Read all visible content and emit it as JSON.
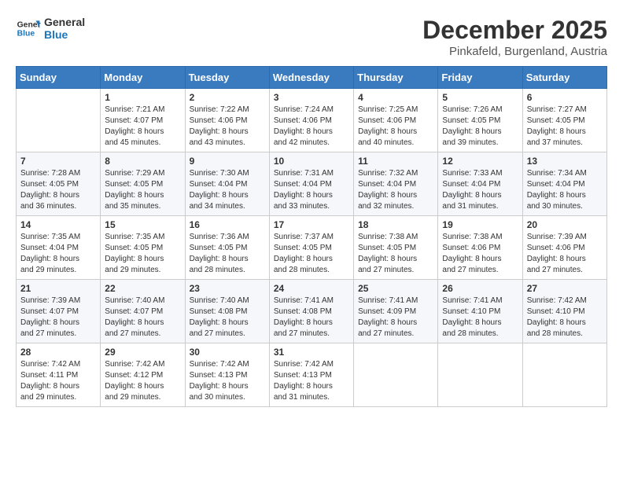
{
  "logo": {
    "line1": "General",
    "line2": "Blue"
  },
  "title": "December 2025",
  "subtitle": "Pinkafeld, Burgenland, Austria",
  "weekdays": [
    "Sunday",
    "Monday",
    "Tuesday",
    "Wednesday",
    "Thursday",
    "Friday",
    "Saturday"
  ],
  "weeks": [
    [
      {
        "day": "",
        "info": ""
      },
      {
        "day": "1",
        "info": "Sunrise: 7:21 AM\nSunset: 4:07 PM\nDaylight: 8 hours\nand 45 minutes."
      },
      {
        "day": "2",
        "info": "Sunrise: 7:22 AM\nSunset: 4:06 PM\nDaylight: 8 hours\nand 43 minutes."
      },
      {
        "day": "3",
        "info": "Sunrise: 7:24 AM\nSunset: 4:06 PM\nDaylight: 8 hours\nand 42 minutes."
      },
      {
        "day": "4",
        "info": "Sunrise: 7:25 AM\nSunset: 4:06 PM\nDaylight: 8 hours\nand 40 minutes."
      },
      {
        "day": "5",
        "info": "Sunrise: 7:26 AM\nSunset: 4:05 PM\nDaylight: 8 hours\nand 39 minutes."
      },
      {
        "day": "6",
        "info": "Sunrise: 7:27 AM\nSunset: 4:05 PM\nDaylight: 8 hours\nand 37 minutes."
      }
    ],
    [
      {
        "day": "7",
        "info": "Sunrise: 7:28 AM\nSunset: 4:05 PM\nDaylight: 8 hours\nand 36 minutes."
      },
      {
        "day": "8",
        "info": "Sunrise: 7:29 AM\nSunset: 4:05 PM\nDaylight: 8 hours\nand 35 minutes."
      },
      {
        "day": "9",
        "info": "Sunrise: 7:30 AM\nSunset: 4:04 PM\nDaylight: 8 hours\nand 34 minutes."
      },
      {
        "day": "10",
        "info": "Sunrise: 7:31 AM\nSunset: 4:04 PM\nDaylight: 8 hours\nand 33 minutes."
      },
      {
        "day": "11",
        "info": "Sunrise: 7:32 AM\nSunset: 4:04 PM\nDaylight: 8 hours\nand 32 minutes."
      },
      {
        "day": "12",
        "info": "Sunrise: 7:33 AM\nSunset: 4:04 PM\nDaylight: 8 hours\nand 31 minutes."
      },
      {
        "day": "13",
        "info": "Sunrise: 7:34 AM\nSunset: 4:04 PM\nDaylight: 8 hours\nand 30 minutes."
      }
    ],
    [
      {
        "day": "14",
        "info": "Sunrise: 7:35 AM\nSunset: 4:04 PM\nDaylight: 8 hours\nand 29 minutes."
      },
      {
        "day": "15",
        "info": "Sunrise: 7:35 AM\nSunset: 4:05 PM\nDaylight: 8 hours\nand 29 minutes."
      },
      {
        "day": "16",
        "info": "Sunrise: 7:36 AM\nSunset: 4:05 PM\nDaylight: 8 hours\nand 28 minutes."
      },
      {
        "day": "17",
        "info": "Sunrise: 7:37 AM\nSunset: 4:05 PM\nDaylight: 8 hours\nand 28 minutes."
      },
      {
        "day": "18",
        "info": "Sunrise: 7:38 AM\nSunset: 4:05 PM\nDaylight: 8 hours\nand 27 minutes."
      },
      {
        "day": "19",
        "info": "Sunrise: 7:38 AM\nSunset: 4:06 PM\nDaylight: 8 hours\nand 27 minutes."
      },
      {
        "day": "20",
        "info": "Sunrise: 7:39 AM\nSunset: 4:06 PM\nDaylight: 8 hours\nand 27 minutes."
      }
    ],
    [
      {
        "day": "21",
        "info": "Sunrise: 7:39 AM\nSunset: 4:07 PM\nDaylight: 8 hours\nand 27 minutes."
      },
      {
        "day": "22",
        "info": "Sunrise: 7:40 AM\nSunset: 4:07 PM\nDaylight: 8 hours\nand 27 minutes."
      },
      {
        "day": "23",
        "info": "Sunrise: 7:40 AM\nSunset: 4:08 PM\nDaylight: 8 hours\nand 27 minutes."
      },
      {
        "day": "24",
        "info": "Sunrise: 7:41 AM\nSunset: 4:08 PM\nDaylight: 8 hours\nand 27 minutes."
      },
      {
        "day": "25",
        "info": "Sunrise: 7:41 AM\nSunset: 4:09 PM\nDaylight: 8 hours\nand 27 minutes."
      },
      {
        "day": "26",
        "info": "Sunrise: 7:41 AM\nSunset: 4:10 PM\nDaylight: 8 hours\nand 28 minutes."
      },
      {
        "day": "27",
        "info": "Sunrise: 7:42 AM\nSunset: 4:10 PM\nDaylight: 8 hours\nand 28 minutes."
      }
    ],
    [
      {
        "day": "28",
        "info": "Sunrise: 7:42 AM\nSunset: 4:11 PM\nDaylight: 8 hours\nand 29 minutes."
      },
      {
        "day": "29",
        "info": "Sunrise: 7:42 AM\nSunset: 4:12 PM\nDaylight: 8 hours\nand 29 minutes."
      },
      {
        "day": "30",
        "info": "Sunrise: 7:42 AM\nSunset: 4:13 PM\nDaylight: 8 hours\nand 30 minutes."
      },
      {
        "day": "31",
        "info": "Sunrise: 7:42 AM\nSunset: 4:13 PM\nDaylight: 8 hours\nand 31 minutes."
      },
      {
        "day": "",
        "info": ""
      },
      {
        "day": "",
        "info": ""
      },
      {
        "day": "",
        "info": ""
      }
    ]
  ]
}
